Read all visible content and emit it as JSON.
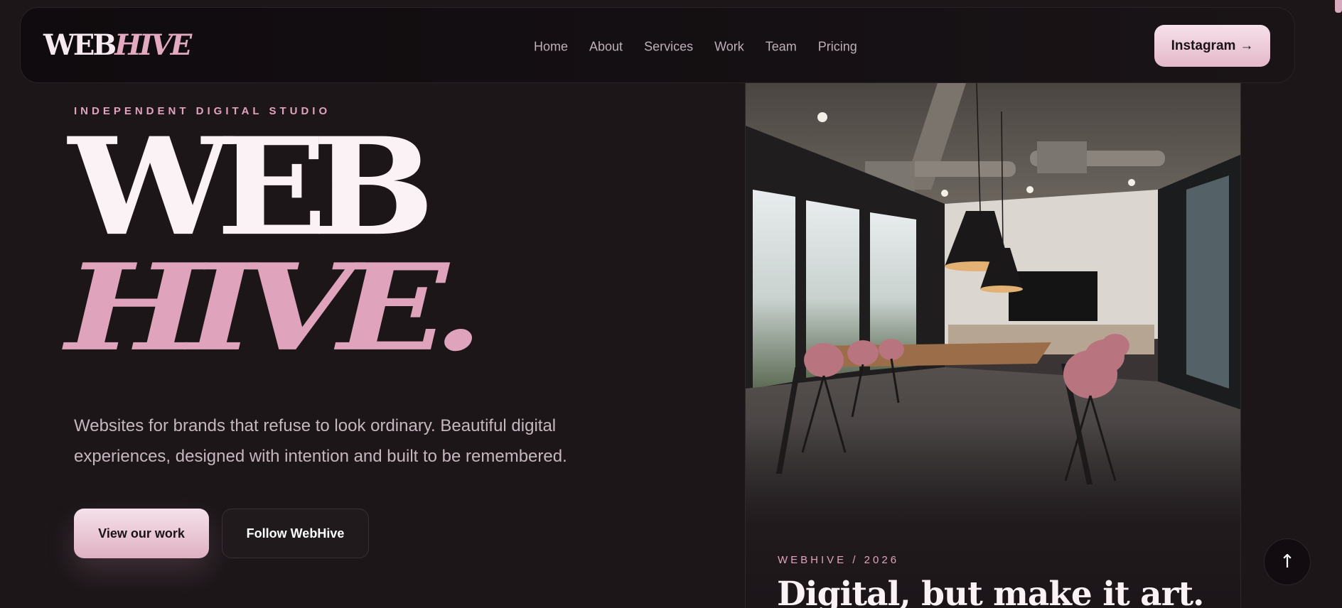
{
  "brand": {
    "logo_web": "WEB",
    "logo_hive": "HIVE"
  },
  "nav": {
    "items": [
      "Home",
      "About",
      "Services",
      "Work",
      "Team",
      "Pricing"
    ],
    "cta_label": "Instagram",
    "cta_arrow": "→"
  },
  "hero": {
    "eyebrow": "INDEPENDENT DIGITAL STUDIO",
    "title_line1": "WEB",
    "title_line2": "HIVE.",
    "lead": "Websites for brands that refuse to look ordinary. Beautiful digital experiences, designed with intention and built to be remembered.",
    "primary_button": "View our work",
    "secondary_button": "Follow WebHive"
  },
  "card": {
    "tag": "WEBHIVE / 2026",
    "title": "Digital, but make it art."
  },
  "back_to_top": {
    "glyph": "↑"
  },
  "colors": {
    "background": "#1c1619",
    "accent_pink": "#dfa4bb",
    "text_light": "#fbf2f6",
    "text_muted": "#c6b7be"
  }
}
